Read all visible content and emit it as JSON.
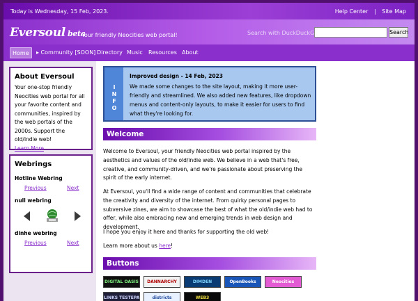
{
  "topbar": {
    "date": "Today is Wednesday, 15 Feb, 2023.",
    "help": "Help Center",
    "separator": "|",
    "sitemap": "Site Map"
  },
  "header": {
    "logo": "Eversoul",
    "beta": "beta",
    "tagline": "Your friendly Neocities web portal!",
    "search_label": "Search with DuckDuckGo!",
    "search_placeholder": "",
    "search_button": "Search"
  },
  "nav": {
    "items": [
      "Home",
      "▸ Community [SOON]",
      "Directory",
      "Music",
      "Resources",
      "About"
    ]
  },
  "about": {
    "title": "About Eversoul",
    "text": "Your one-stop friendly Neocities web portal for all your favorite content and communities, inspired by the web portals of the 2000s. Support the old/indie web!",
    "more": "Learn More"
  },
  "webrings": {
    "title": "Webrings",
    "rings": [
      {
        "name": "Hotline Webring",
        "prev": "Previous",
        "next": "Next"
      },
      {
        "name": "null webring"
      },
      {
        "name": "dinhe webring",
        "prev": "Previous",
        "next": "Next"
      }
    ]
  },
  "info": {
    "tab": [
      "I",
      "N",
      "F",
      "O"
    ],
    "title": "Improved design - 14 Feb, 2023",
    "text": "We made some changes to the site layout, making it more user-friendly and streamlined. We also added new features, like dropdown menus and content-only layouts, to make it easier for users to find what they're looking for."
  },
  "welcome": {
    "heading": "Welcome",
    "p1": "Welcome to Eversoul, your friendly Neocities web portal inspired by the aesthetics and values of the old/indie web. We believe in a web that's free, creative, and community-driven, and we're passionate about preserving the spirit of the early internet.",
    "p2": "At Eversoul, you'll find a wide range of content and communities that celebrate the creativity and diversity of the internet. From quirky personal pages to subversive zines, we aim to showcase the best of what the old/indie web had to offer, while also embracing new and emerging trends in web design and development.",
    "p3": "I hope you enjoy it here and thanks for supporting the old web!",
    "p4_prefix": "Learn more about us ",
    "p4_link": "here",
    "p4_suffix": "!"
  },
  "buttons": {
    "heading": "Buttons",
    "row1": [
      "DIGITAL OASIS",
      "DANNARCHY",
      "DIMDEN",
      "OpenBooks",
      "Neocities"
    ],
    "row2": [
      "LINKS TESTEPAGES",
      "districts",
      "WEB3"
    ]
  }
}
